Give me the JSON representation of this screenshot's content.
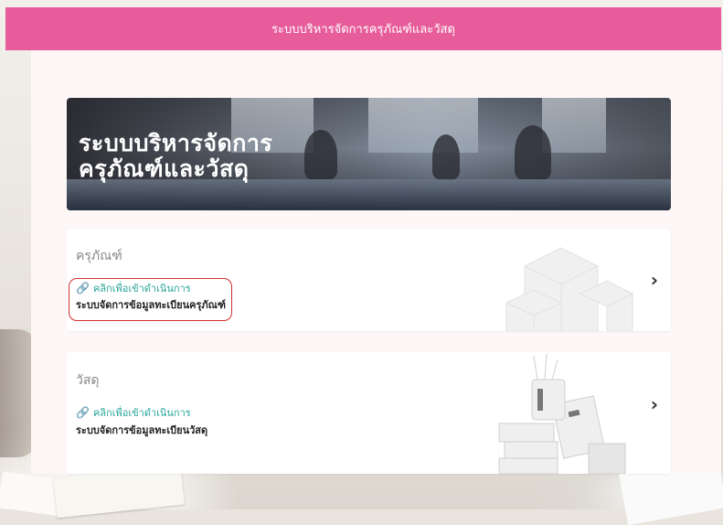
{
  "header": {
    "title": "ระบบบริหารจัดการครุภัณฑ์และวัสดุ"
  },
  "banner": {
    "title_line1": "ระบบบริหารจัดการ",
    "title_line2": "ครุภัณฑ์และวัสดุ"
  },
  "cards": [
    {
      "title": "ครุภัณฑ์",
      "link_label": "คลิกเพื่อเข้าดำเนินการ",
      "description": "ระบบจัดการข้อมูลทะเบียนครุภัณฑ์",
      "chevron": "›",
      "highlighted": true
    },
    {
      "title": "วัสดุ",
      "link_label": "คลิกเพื่อเข้าดำเนินการ",
      "description": "ระบบจัดการข้อมูลทะเบียนวัสดุ",
      "chevron": "›",
      "highlighted": false
    }
  ],
  "colors": {
    "header": "#e75c9b",
    "link": "#2aa59b",
    "highlight": "#d23030"
  },
  "icons": {
    "link": "link-icon",
    "chevron": "chevron-right-icon",
    "card1_illustration": "boxes-illustration",
    "card2_illustration": "office-supplies-illustration"
  }
}
